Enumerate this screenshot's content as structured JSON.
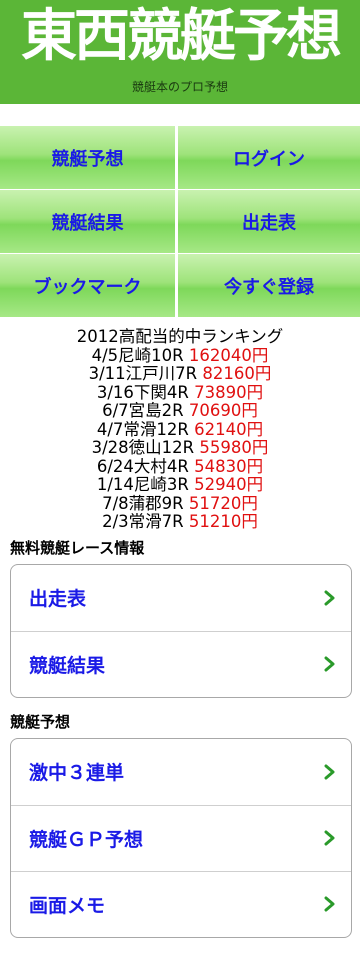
{
  "header": {
    "title": "東西競艇予想",
    "tagline": "競艇本のプロ予想"
  },
  "menu": {
    "row1": [
      "競艇予想",
      "ログイン"
    ],
    "row2": [
      "競艇結果",
      "出走表"
    ],
    "row3": [
      "ブックマーク",
      "今すぐ登録"
    ]
  },
  "ranking": {
    "title": "2012高配当的中ランキング",
    "items": [
      {
        "race": "4/5尼崎10R",
        "amount": "162040円"
      },
      {
        "race": "3/11江戸川7R",
        "amount": "82160円"
      },
      {
        "race": "3/16下関4R",
        "amount": "73890円"
      },
      {
        "race": "6/7宮島2R",
        "amount": "70690円"
      },
      {
        "race": "4/7常滑12R",
        "amount": "62140円"
      },
      {
        "race": "3/28徳山12R",
        "amount": "55980円"
      },
      {
        "race": "6/24大村4R",
        "amount": "54830円"
      },
      {
        "race": "1/14尼崎3R",
        "amount": "52940円"
      },
      {
        "race": "7/8蒲郡9R",
        "amount": "51720円"
      },
      {
        "race": "2/3常滑7R",
        "amount": "51210円"
      }
    ]
  },
  "free_section": {
    "title": "無料競艇レース情報",
    "items": [
      "出走表",
      "競艇結果"
    ]
  },
  "yoso_section": {
    "title": "競艇予想",
    "items": [
      "激中３連単",
      "競艇ＧＰ予想",
      "画面メモ"
    ]
  },
  "colors": {
    "header_bg": "#5bb637",
    "link": "#1a1ae6",
    "amount": "#e01010",
    "chevron": "#2a9a2a"
  },
  "icons": {
    "row_arrow": "chevron-right-icon"
  }
}
